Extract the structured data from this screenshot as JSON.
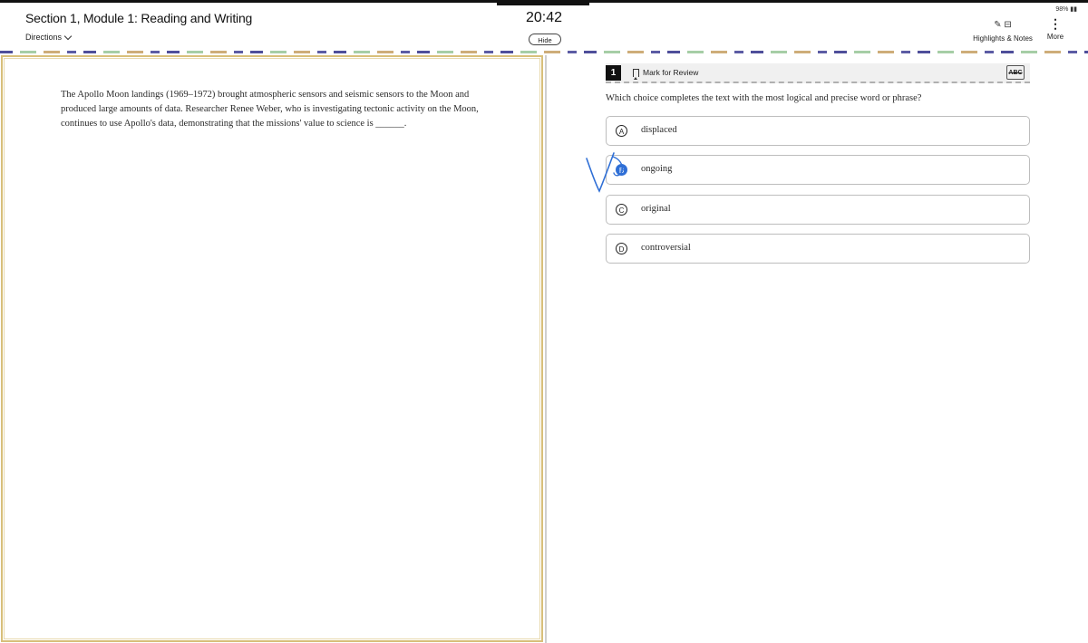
{
  "status_bar": {
    "battery": "98% ▮▮"
  },
  "header": {
    "section_title": "Section 1, Module 1: Reading and Writing",
    "directions_label": "Directions",
    "timer": "20:42",
    "hide_label": "Hide",
    "tools_icons": "✎ ⊟",
    "tools_label": "Highlights & Notes",
    "more_icon": "⋮",
    "more_label": "More"
  },
  "passage": {
    "text": "The Apollo Moon landings (1969–1972) brought atmospheric sensors and seismic sensors to the Moon and produced large amounts of data. Researcher Renee Weber, who is investigating tectonic activity on the Moon, continues to use Apollo's data, demonstrating that the missions' value to science is ______."
  },
  "question": {
    "number": "1",
    "mark_for_review": "Mark for Review",
    "abc_label": "ABC",
    "prompt": "Which choice completes the text with the most logical and precise word or phrase?",
    "options": [
      {
        "letter": "A",
        "text": "displaced"
      },
      {
        "letter": "B",
        "text": "ongoing"
      },
      {
        "letter": "C",
        "text": "original"
      },
      {
        "letter": "D",
        "text": "controversial"
      }
    ],
    "selected": "B"
  },
  "colors": {
    "accent_blue": "#2f6fd6",
    "passage_border": "#d8bf7a"
  }
}
